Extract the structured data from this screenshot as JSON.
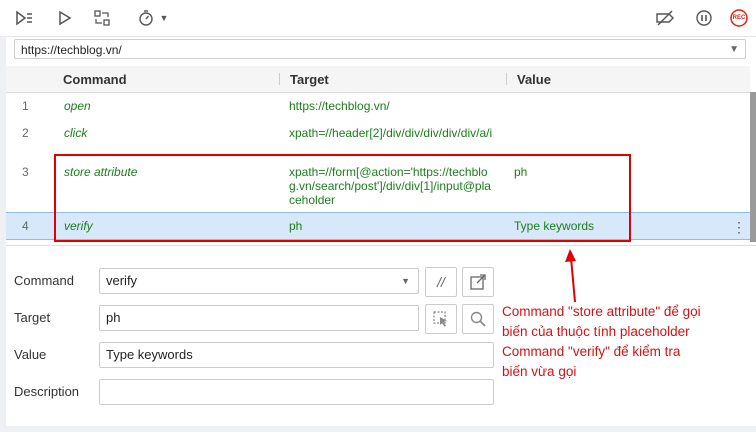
{
  "toolbar": {
    "icons": [
      "run-all-icon",
      "run-icon",
      "record-loop-icon",
      "timer-icon",
      "chevron-down-icon",
      "disable-breakpoints-icon",
      "pause-icon",
      "record-icon"
    ],
    "rec_label": "REC"
  },
  "url": "https://techblog.vn/",
  "table": {
    "headers": {
      "command": "Command",
      "target": "Target",
      "value": "Value"
    },
    "rows": [
      {
        "num": "1",
        "command": "open",
        "target": "https://techblog.vn/",
        "value": ""
      },
      {
        "num": "2",
        "command": "click",
        "target": "xpath=//header[2]/div/div/div/div/div/a/i",
        "value": ""
      },
      {
        "num": "3",
        "command": "store attribute",
        "target": "xpath=//form[@action='https://techblog.vn/search/post']/div/div[1]/input@placeholder",
        "value": "ph"
      },
      {
        "num": "4",
        "command": "verify",
        "target": "ph",
        "value": "Type keywords"
      }
    ],
    "selected_row": "4"
  },
  "editor": {
    "command_label": "Command",
    "command_value": "verify",
    "target_label": "Target",
    "target_value": "ph",
    "value_label": "Value",
    "value_value": "Type keywords",
    "description_label": "Description",
    "description_value": "",
    "comment_btn": "//"
  },
  "annotation": {
    "lines": [
      "Command \"store attribute\" để gọi",
      "biến của thuộc tính placeholder",
      "Command \"verify\" để kiểm tra",
      "biến vừa gọi"
    ],
    "color": "#d91010"
  }
}
